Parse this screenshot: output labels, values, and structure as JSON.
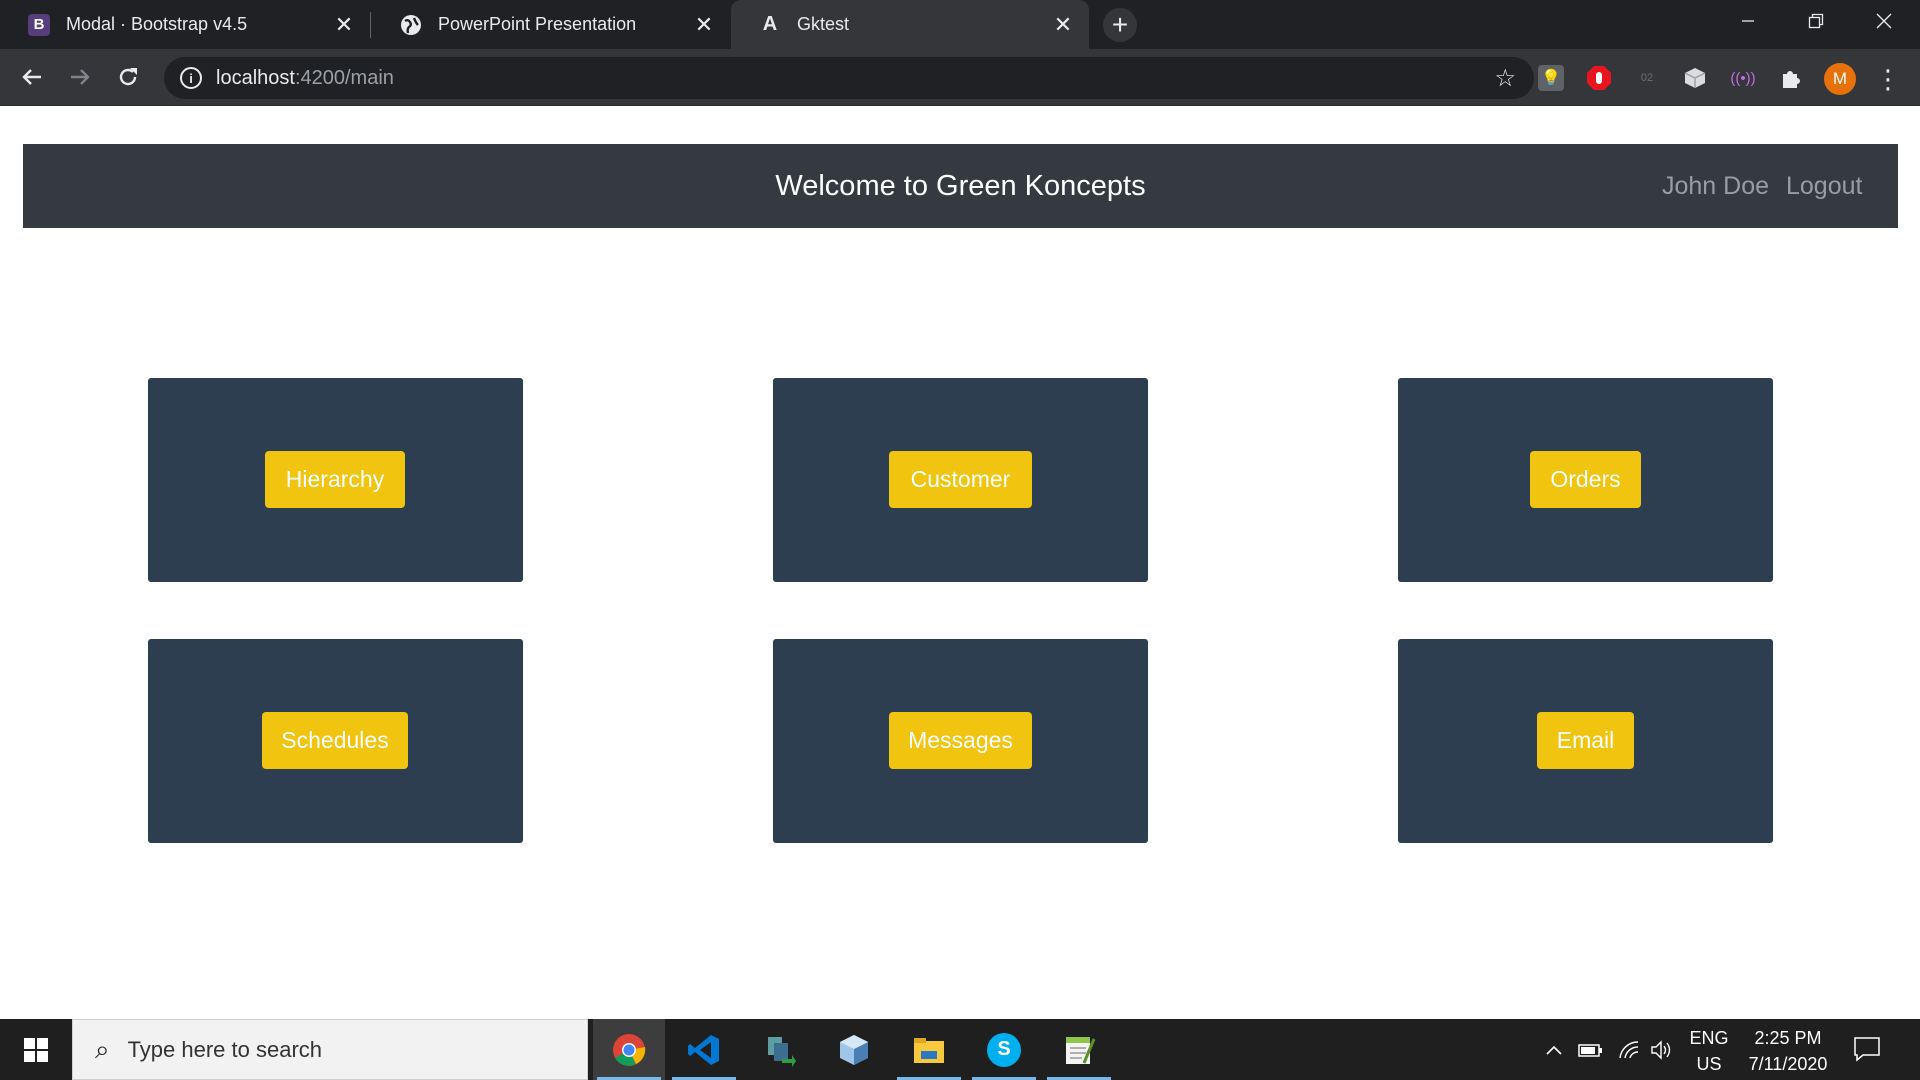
{
  "browser": {
    "tabs": [
      {
        "title": "Modal · Bootstrap v4.5",
        "favicon": "B",
        "favicon_color": "#563d7c",
        "active": false
      },
      {
        "title": "PowerPoint Presentation",
        "favicon": "globe-icon",
        "active": false
      },
      {
        "title": "Gktest",
        "favicon": "A",
        "active": true
      }
    ],
    "new_tab_glyph": "+",
    "url_host": "localhost",
    "url_path": ":4200/main",
    "profile_initial": "M"
  },
  "app": {
    "title": "Welcome to Green Koncepts",
    "user_name": "John Doe",
    "logout_label": "Logout",
    "colors": {
      "header_bg": "#343a40",
      "card_bg": "#2c3e50",
      "button_bg": "#f1c40f"
    },
    "tiles": [
      {
        "label": "Hierarchy"
      },
      {
        "label": "Customer"
      },
      {
        "label": "Orders"
      },
      {
        "label": "Schedules"
      },
      {
        "label": "Messages"
      },
      {
        "label": "Email"
      }
    ]
  },
  "taskbar": {
    "search_placeholder": "Type here to search",
    "apps": [
      "chrome-icon",
      "vscode-icon",
      "file-transfer-icon",
      "cube-icon",
      "file-explorer-icon",
      "skype-icon",
      "notepad-plus-icon"
    ],
    "lang_top": "ENG",
    "lang_bottom": "US",
    "time": "2:25 PM",
    "date": "7/11/2020"
  }
}
